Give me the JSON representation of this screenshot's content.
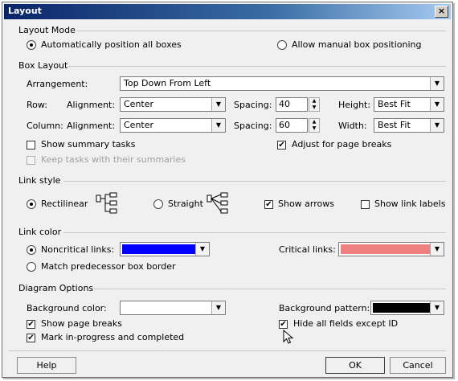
{
  "window": {
    "title": "Layout",
    "close_glyph": "×"
  },
  "layout_mode": {
    "header": "Layout Mode",
    "auto_label": "Automatically position all boxes",
    "manual_label": "Allow manual box positioning"
  },
  "box_layout": {
    "header": "Box Layout",
    "arrangement_label": "Arrangement:",
    "arrangement_value": "Top Down From Left",
    "row_label": "Row:",
    "row_alignment_label": "Alignment:",
    "row_alignment_value": "Center",
    "row_spacing_label": "Spacing:",
    "row_spacing_value": "40",
    "height_label": "Height:",
    "height_value": "Best Fit",
    "column_label": "Column:",
    "column_alignment_label": "Alignment:",
    "column_alignment_value": "Center",
    "column_spacing_label": "Spacing:",
    "column_spacing_value": "60",
    "width_label": "Width:",
    "width_value": "Best Fit",
    "show_summary_label": "Show summary tasks",
    "keep_tasks_label": "Keep tasks with their summaries",
    "adjust_breaks_label": "Adjust for page breaks"
  },
  "link_style": {
    "header": "Link style",
    "rectilinear_label": "Rectilinear",
    "straight_label": "Straight",
    "show_arrows_label": "Show arrows",
    "show_link_labels_label": "Show link labels"
  },
  "link_color": {
    "header": "Link color",
    "noncritical_label": "Noncritical links:",
    "noncritical_color": "#0000ff",
    "critical_label": "Critical links:",
    "critical_color": "#f08080",
    "match_label": "Match predecessor box border"
  },
  "diagram_options": {
    "header": "Diagram Options",
    "background_color_label": "Background color:",
    "background_color": "#ffffff",
    "background_pattern_label": "Background pattern:",
    "background_pattern_color": "#000000",
    "show_page_breaks_label": "Show page breaks",
    "mark_progress_label": "Mark in-progress and completed",
    "hide_fields_label": "Hide all fields except ID"
  },
  "buttons": {
    "help": "Help",
    "ok": "OK",
    "cancel": "Cancel"
  },
  "glyphs": {
    "check": "✔",
    "dropdown": "▼",
    "spin_up": "▲",
    "spin_down": "▼"
  }
}
